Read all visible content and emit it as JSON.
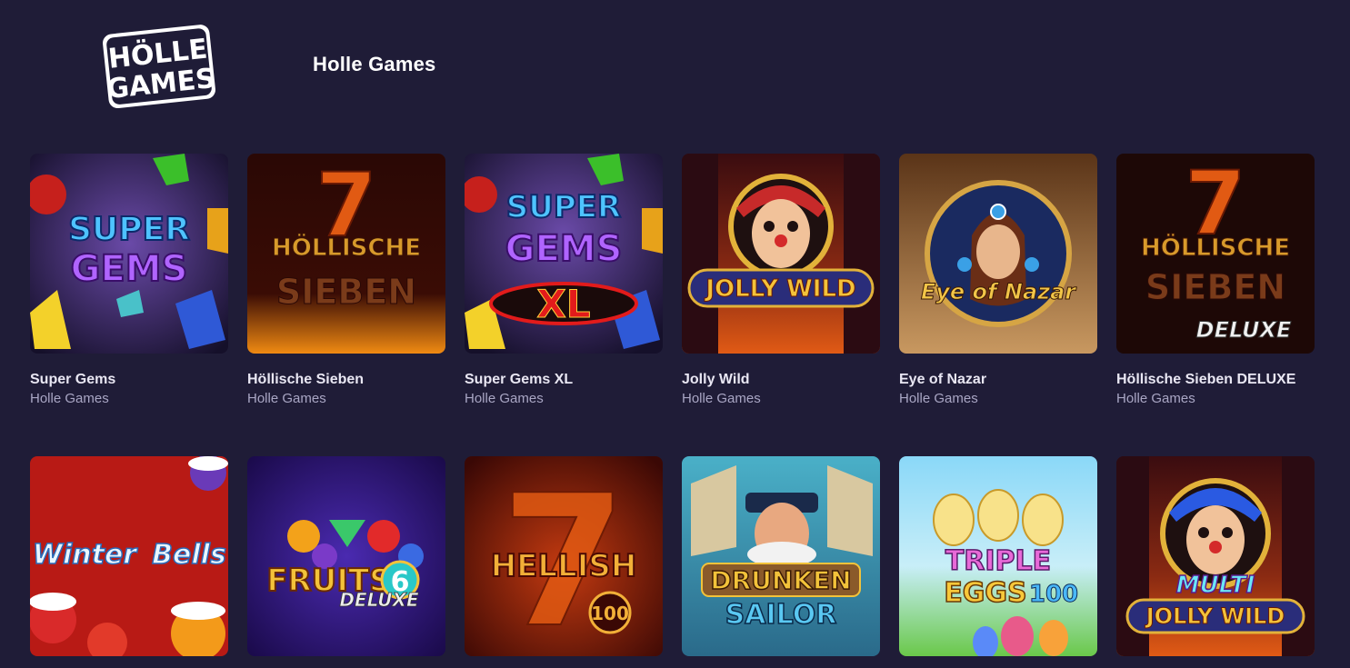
{
  "header": {
    "logo_text_line1": "HÖLLE",
    "logo_text_line2": "GAMES",
    "provider_title": "Holle Games"
  },
  "games": [
    {
      "title": "Super Gems",
      "provider": "Holle Games",
      "art": "super-gems",
      "art_lines": [
        "SUPER",
        "GEMS"
      ]
    },
    {
      "title": "Höllische Sieben",
      "provider": "Holle Games",
      "art": "hoellische-sieben",
      "art_lines": [
        "7",
        "HÖLLISCHE",
        "SIEBEN"
      ]
    },
    {
      "title": "Super Gems XL",
      "provider": "Holle Games",
      "art": "super-gems-xl",
      "art_lines": [
        "SUPER",
        "GEMS",
        "XL"
      ]
    },
    {
      "title": "Jolly Wild",
      "provider": "Holle Games",
      "art": "jolly-wild",
      "art_lines": [
        "JOLLY WILD"
      ]
    },
    {
      "title": "Eye of Nazar",
      "provider": "Holle Games",
      "art": "eye-of-nazar",
      "art_lines": [
        "Eye of Nazar"
      ]
    },
    {
      "title": "Höllische Sieben DELUXE",
      "provider": "Holle Games",
      "art": "hoellische-sieben-deluxe",
      "art_lines": [
        "7",
        "HÖLLISCHE",
        "SIEBEN",
        "DELUXE"
      ]
    },
    {
      "title": "",
      "provider": "",
      "art": "winter-bells",
      "art_lines": [
        "Winter",
        "Bells"
      ]
    },
    {
      "title": "",
      "provider": "",
      "art": "fruits-6-deluxe",
      "art_lines": [
        "FRUITS",
        "6",
        "DELUXE"
      ]
    },
    {
      "title": "",
      "provider": "",
      "art": "hellish-100",
      "art_lines": [
        "7",
        "HELLISH",
        "100"
      ]
    },
    {
      "title": "",
      "provider": "",
      "art": "drunken-sailor",
      "art_lines": [
        "DRUNKEN",
        "SAILOR"
      ]
    },
    {
      "title": "",
      "provider": "",
      "art": "triple-eggs-100",
      "art_lines": [
        "TRIPLE",
        "EGGS",
        "100"
      ]
    },
    {
      "title": "",
      "provider": "",
      "art": "multi-jolly-wild",
      "art_lines": [
        "MULTI",
        "JOLLY WILD"
      ]
    }
  ],
  "colors": {
    "background": "#1f1c37",
    "title_text": "#e9e7f3",
    "provider_text": "#a9a6c4"
  }
}
